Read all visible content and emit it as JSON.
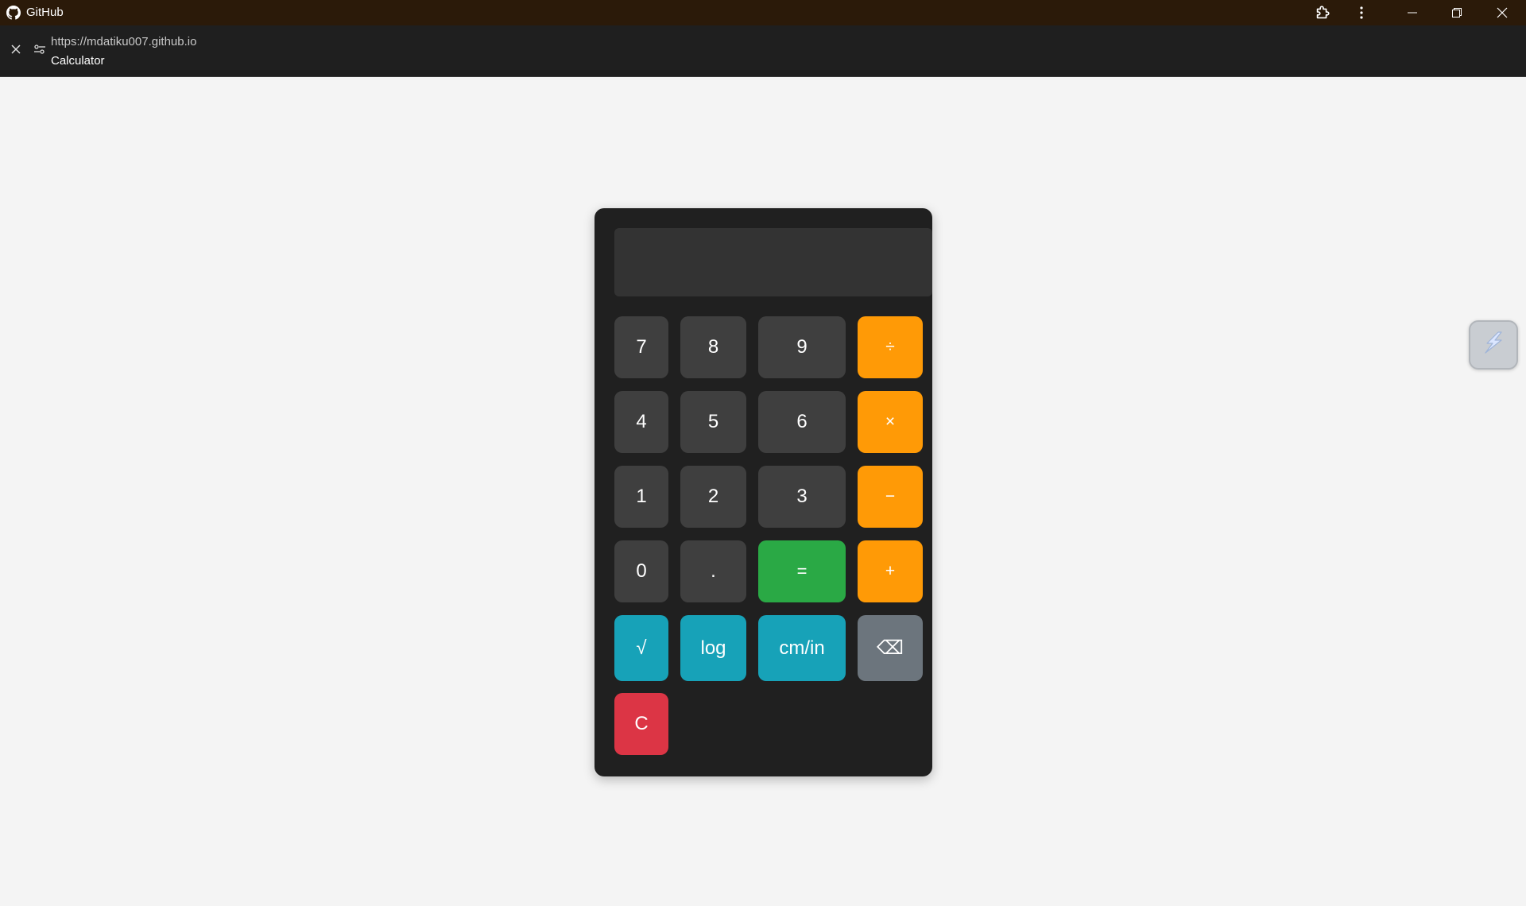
{
  "window": {
    "app_name": "GitHub",
    "icons": {
      "logo": "github-logo-icon",
      "extension": "puzzle-extension-icon",
      "menu": "more-vertical-icon",
      "minimize": "minimize-icon",
      "restore": "restore-icon",
      "close": "close-icon"
    }
  },
  "addressbar": {
    "url": "https://mdatiku007.github.io",
    "page_title": "Calculator",
    "icons": {
      "close": "close-icon",
      "settings": "site-settings-icon"
    }
  },
  "calculator": {
    "display_value": "",
    "keys": {
      "k7": "7",
      "k8": "8",
      "k9": "9",
      "divide": "÷",
      "k4": "4",
      "k5": "5",
      "k6": "6",
      "multiply": "×",
      "k1": "1",
      "k2": "2",
      "k3": "3",
      "subtract": "−",
      "k0": "0",
      "dot": ".",
      "equals": "=",
      "add": "+",
      "sqrt": "√",
      "log": "log",
      "cm_in": "cm/in",
      "backspace": "⌫",
      "clear": "C"
    },
    "colors": {
      "body": "#202020",
      "display": "#333333",
      "number_key": "#3f3f3f",
      "operator_key": "#ff9a06",
      "equals_key": "#2aa945",
      "function_key": "#17a2b8",
      "backspace_key": "#6c757d",
      "clear_key": "#dc3545"
    }
  },
  "side_widget": {
    "icon": "extension-widget-icon"
  }
}
